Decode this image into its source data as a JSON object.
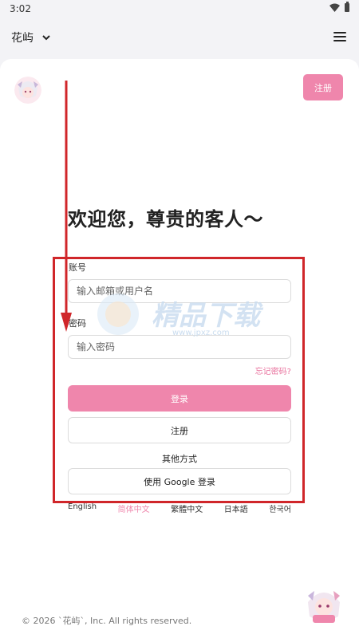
{
  "status_bar": {
    "time": "3:02"
  },
  "app_bar": {
    "title": "花屿"
  },
  "header": {
    "register_label": "注册"
  },
  "login": {
    "welcome": "欢迎您，尊贵的客人〜",
    "account_label": "账号",
    "account_placeholder": "输入邮箱或用户名",
    "password_label": "密码",
    "password_placeholder": "输入密码",
    "forgot_label": "忘记密码?",
    "login_label": "登录",
    "register_label": "注册",
    "other_methods_label": "其他方式",
    "google_label": "使用 Google 登录"
  },
  "languages": [
    {
      "label": "English",
      "active": false
    },
    {
      "label": "简体中文",
      "active": true
    },
    {
      "label": "繁體中文",
      "active": false
    },
    {
      "label": "日本語",
      "active": false
    },
    {
      "label": "한국어",
      "active": false
    }
  ],
  "watermark": {
    "text": "精品下载",
    "url": "www.jpxz.com"
  },
  "footer": {
    "copyright": "© 2026 `花屿`, Inc. All rights reserved."
  },
  "colors": {
    "accent": "#ef86ac",
    "annotation": "#d0262a"
  },
  "icons": [
    "wifi-icon",
    "battery-icon",
    "chevron-down-icon",
    "menu-icon",
    "avatar-icon"
  ]
}
